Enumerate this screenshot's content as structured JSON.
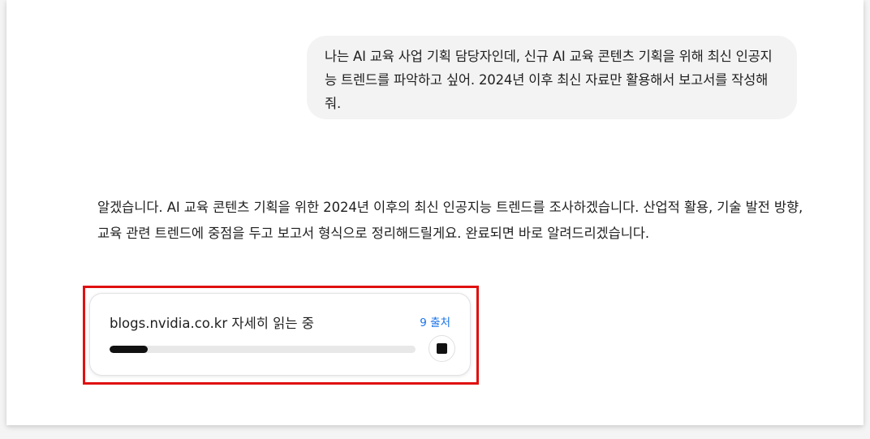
{
  "conversation": {
    "user_message": "나는 AI 교육 사업 기획 담당자인데, 신규 AI 교육 콘텐츠 기획을 위해 최신 인공지능 트렌드를 파악하고 싶어. 2024년 이후 최신 자료만 활용해서 보고서를 작성해줘.",
    "assistant_message": "알겠습니다. AI 교육 콘텐츠 기획을 위한 2024년 이후의 최신 인공지능 트렌드를 조사하겠습니다. 산업적 활용, 기술 발전 방향, 교육 관련 트렌드에 중점을 두고 보고서 형식으로 정리해드릴게요. 완료되면 바로 알려드리겠습니다."
  },
  "research_card": {
    "status_text": "blogs.nvidia.co.kr 자세히 읽는 중",
    "sources_label": "9 출처",
    "progress_fraction": 0.125,
    "stop_icon": "stop-square-icon"
  },
  "colors": {
    "highlight_border": "#e01010",
    "link": "#1a73e8",
    "progress_fill": "#111111",
    "user_bubble_bg": "#f3f3f3"
  }
}
